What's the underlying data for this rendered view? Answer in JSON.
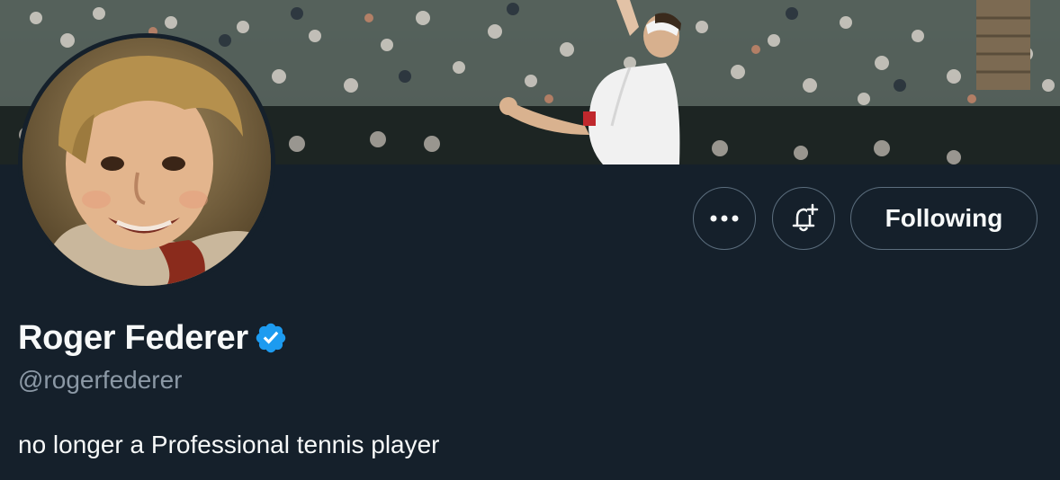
{
  "profile": {
    "display_name": "Roger Federer",
    "handle": "@rogerfederer",
    "bio": "no longer a Professional tennis player",
    "verified": true
  },
  "actions": {
    "more_icon": "more-horizontal-icon",
    "notify_icon": "bell-plus-icon",
    "following_label": "Following"
  },
  "colors": {
    "background": "#15202b",
    "text_primary": "#f7f9f9",
    "text_secondary": "#8b98a5",
    "verified_blue": "#1d9bf0",
    "button_border": "#5c6e7e"
  }
}
